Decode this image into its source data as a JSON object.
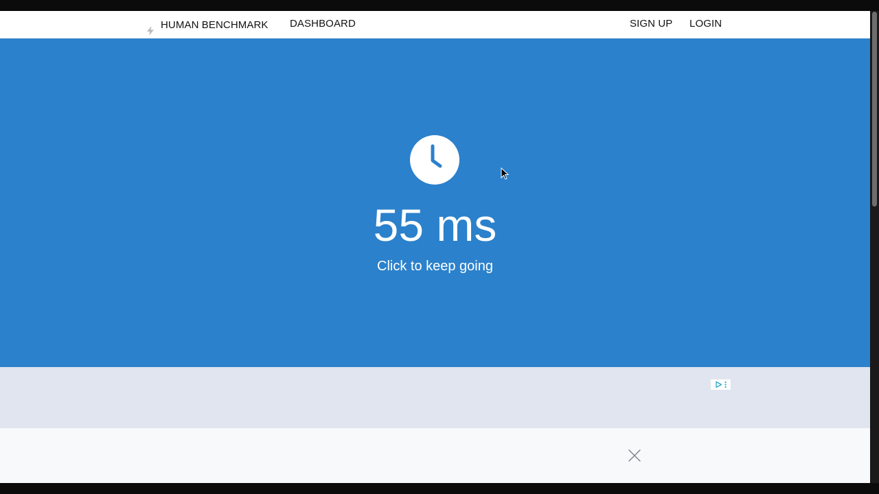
{
  "nav": {
    "brand": "HUMAN BENCHMARK",
    "dashboard": "DASHBOARD",
    "signup": "SIGN UP",
    "login": "LOGIN",
    "brand_icon": "lightning-bolt-icon"
  },
  "test": {
    "result": "55 ms",
    "hint": "Click to keep going",
    "icon": "clock-icon",
    "background_color": "#2b81cb"
  },
  "ad": {
    "adchoices_icon": "adchoices-icon",
    "close_icon": "close-icon"
  },
  "colors": {
    "accent_blue": "#2b81cb",
    "ad_band": "#e1e5ef",
    "sticky_bar": "#f8f9fb"
  }
}
